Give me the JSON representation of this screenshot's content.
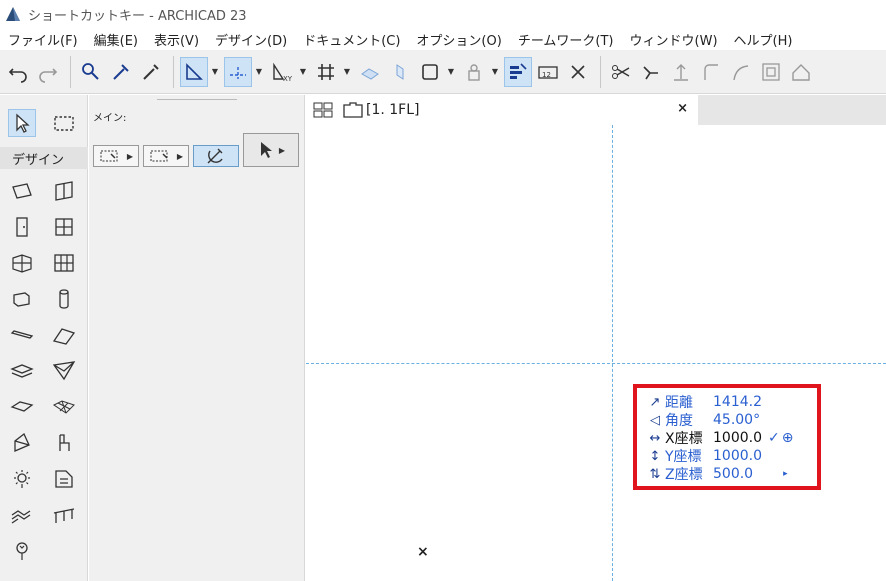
{
  "window": {
    "title": "ショートカットキー - ARCHICAD 23"
  },
  "menu": [
    "ファイル(F)",
    "編集(E)",
    "表示(V)",
    "デザイン(D)",
    "ドキュメント(C)",
    "オプション(O)",
    "チームワーク(T)",
    "ウィンドウ(W)",
    "ヘルプ(H)"
  ],
  "toolbox": {
    "section": "デザイン"
  },
  "infobox": {
    "label": "メイン:"
  },
  "tab": {
    "label": "[1. 1FL]",
    "close": "×"
  },
  "canvas": {
    "origin_marker": "×"
  },
  "tracker": {
    "rows": [
      {
        "icon": "↗",
        "name": "距離",
        "value": "1414.2"
      },
      {
        "icon": "◁",
        "name": "角度",
        "value": "45.00°"
      },
      {
        "icon": "↔",
        "name": "X座標",
        "value": "1000.0"
      },
      {
        "icon": "↕",
        "name": "Y座標",
        "value": "1000.0"
      },
      {
        "icon": "⇅",
        "name": "Z座標",
        "value": "500.0"
      }
    ],
    "check": "✓",
    "crosshair": "⊕",
    "more": "▸"
  },
  "colors": {
    "accent": "#2a5fd0",
    "highlight_border": "#e0141c",
    "guide": "#6ab0e0"
  }
}
